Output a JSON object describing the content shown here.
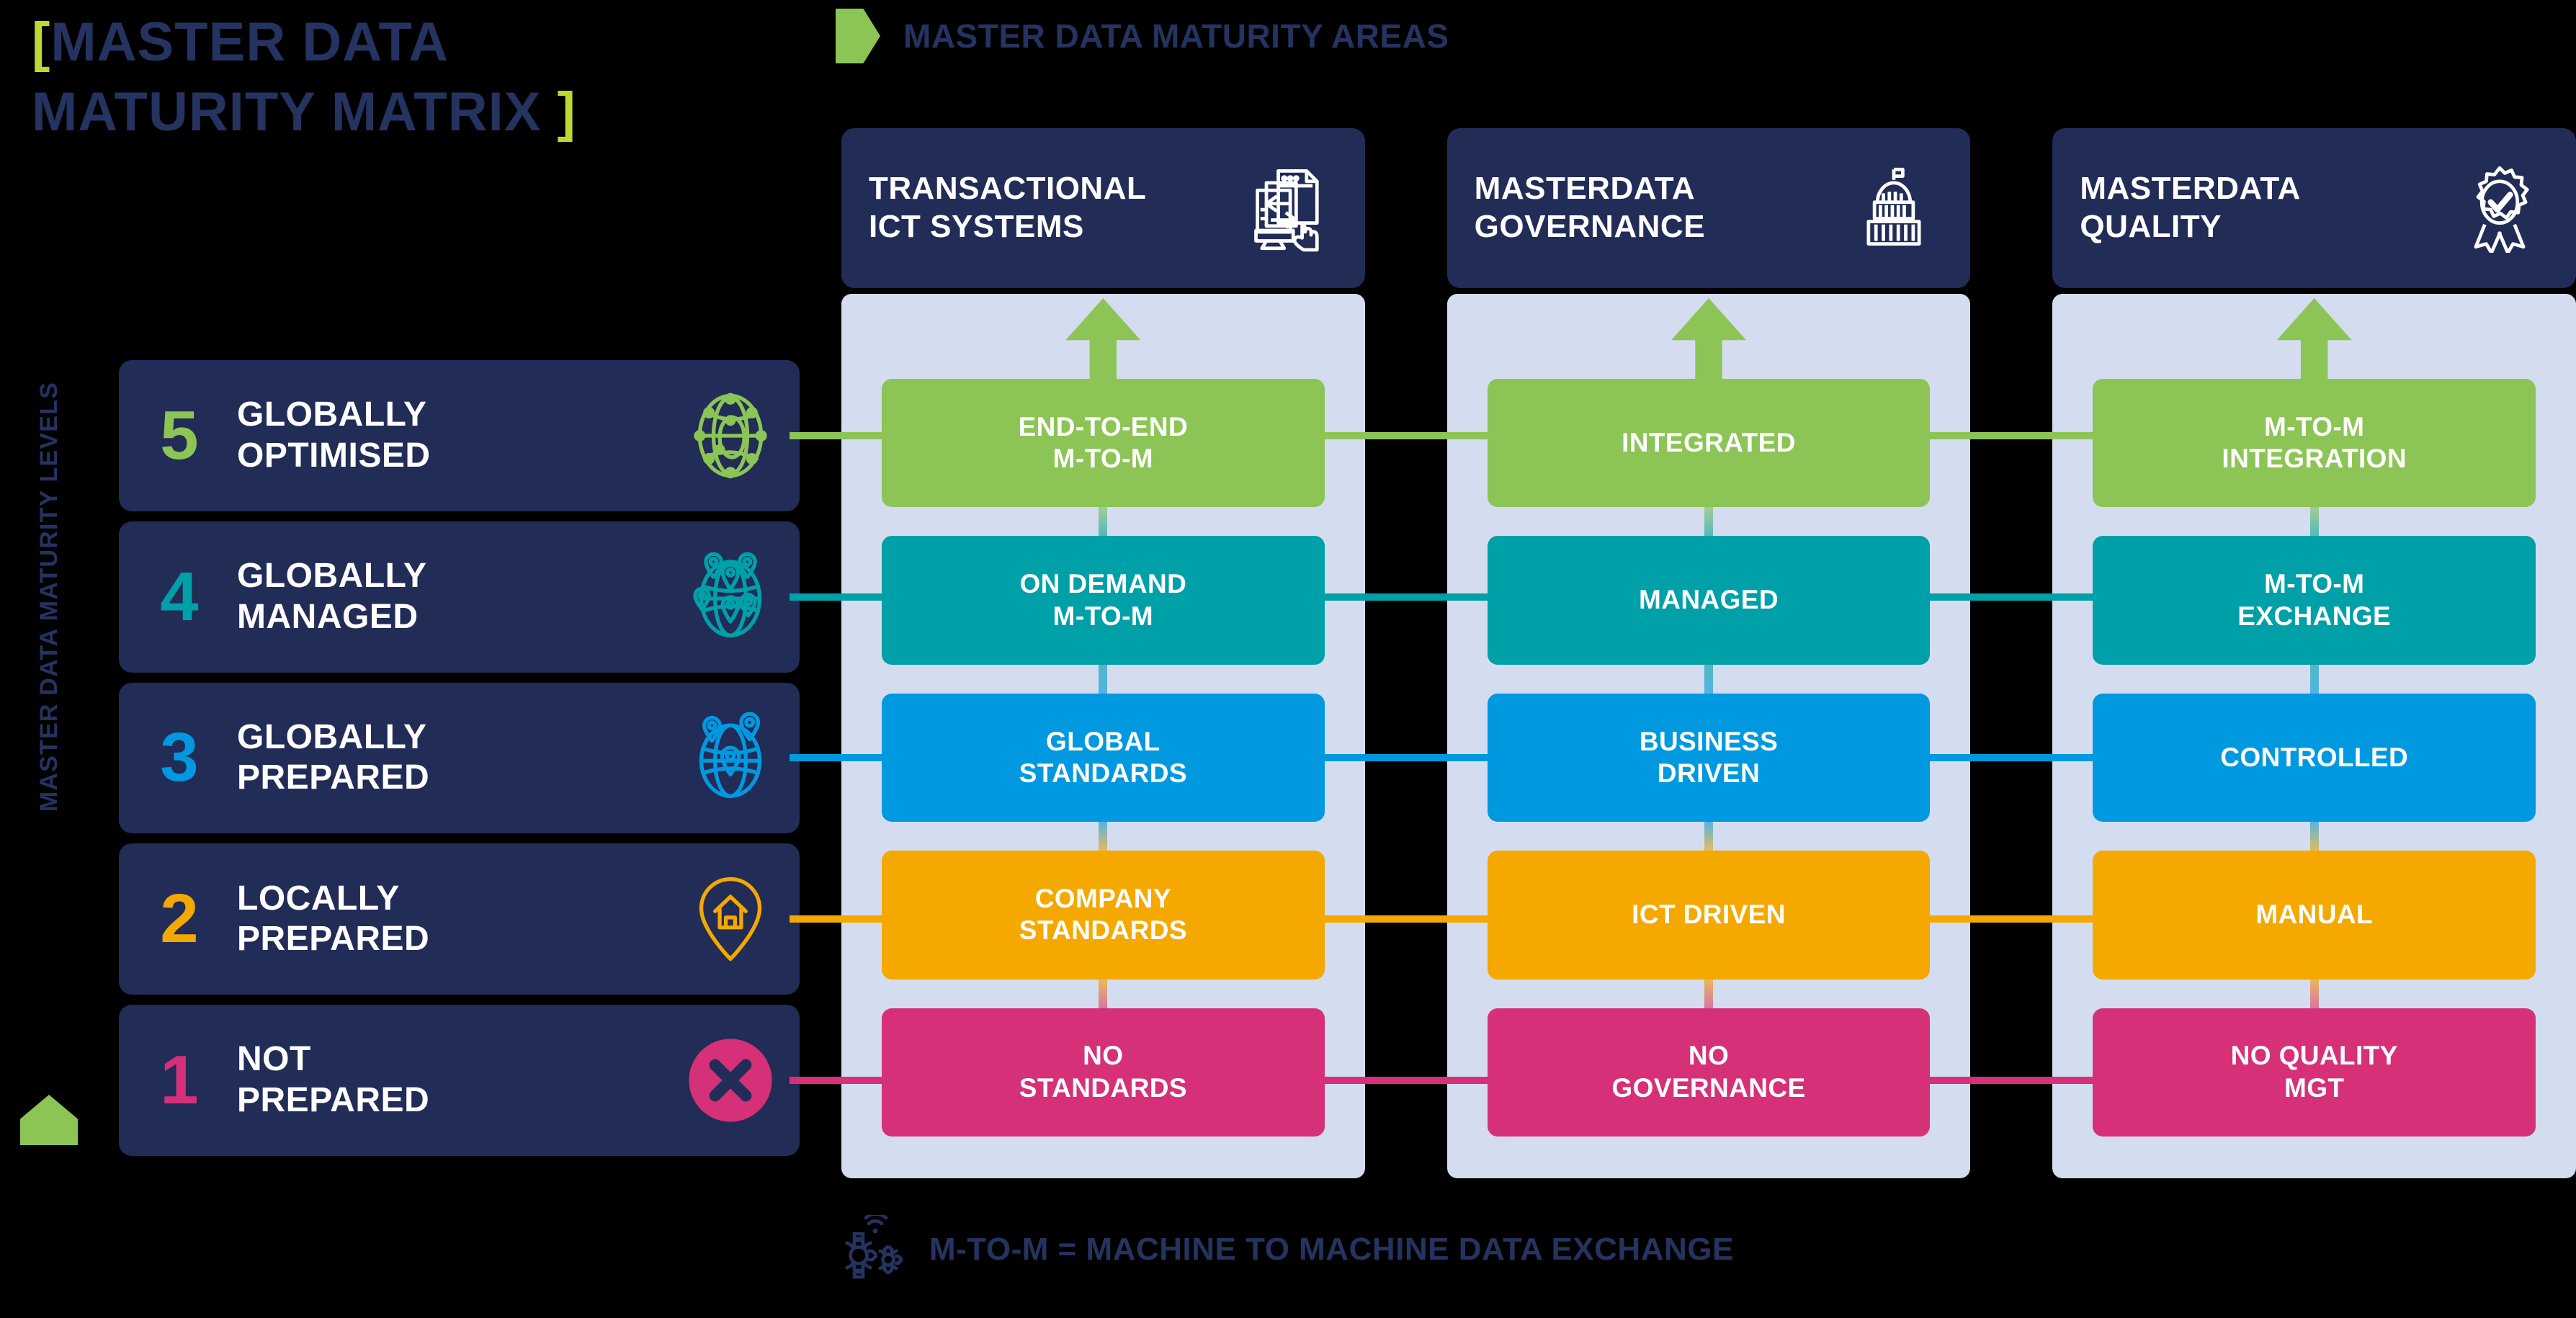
{
  "title": {
    "bracket_open": "[",
    "line1": "MASTER  DATA",
    "line2": "MATURITY MATRIX",
    "bracket_close": "]",
    "bracket_color": "#BFD730",
    "text_color": "#253360"
  },
  "areas_heading": {
    "label": "MASTER DATA MATURITY AREAS",
    "chevron_color": "#8CC456"
  },
  "levels_axis": {
    "label": "MASTER DATA MATURITY LEVELS",
    "arrow_color": "#8CC456"
  },
  "levels": [
    {
      "number": "5",
      "title_line1": "GLOBALLY",
      "title_line2": "OPTIMISED",
      "color": "#8CC456",
      "icon": "globe-network-icon"
    },
    {
      "number": "4",
      "title_line1": "GLOBALLY",
      "title_line2": "MANAGED",
      "color": "#00A0A8",
      "icon": "globe-multi-pin-icon"
    },
    {
      "number": "3",
      "title_line1": "GLOBALLY",
      "title_line2": "PREPARED",
      "color": "#0099E0",
      "icon": "globe-pin-icon"
    },
    {
      "number": "2",
      "title_line1": "LOCALLY",
      "title_line2": "PREPARED",
      "color": "#F5A800",
      "icon": "home-pin-icon"
    },
    {
      "number": "1",
      "title_line1": "NOT",
      "title_line2": "PREPARED",
      "color": "#D63078",
      "icon": "cross-circle-icon"
    }
  ],
  "areas": [
    {
      "title_line1": "TRANSACTIONAL",
      "title_line2": "ICT SYSTEMS",
      "icon": "document-exchange-icon",
      "cells": [
        {
          "line1": "END-TO-END",
          "line2": "M-TO-M"
        },
        {
          "line1": "ON DEMAND",
          "line2": "M-TO-M"
        },
        {
          "line1": "GLOBAL",
          "line2": "STANDARDS"
        },
        {
          "line1": "COMPANY",
          "line2": "STANDARDS"
        },
        {
          "line1": "NO",
          "line2": "STANDARDS"
        }
      ]
    },
    {
      "title_line1": "MASTERDATA",
      "title_line2": "GOVERNANCE",
      "icon": "government-building-icon",
      "cells": [
        {
          "line1": "INTEGRATED",
          "line2": ""
        },
        {
          "line1": "MANAGED",
          "line2": ""
        },
        {
          "line1": "BUSINESS",
          "line2": "DRIVEN"
        },
        {
          "line1": "ICT DRIVEN",
          "line2": ""
        },
        {
          "line1": "NO",
          "line2": "GOVERNANCE"
        }
      ]
    },
    {
      "title_line1": "MASTERDATA",
      "title_line2": "QUALITY",
      "icon": "award-check-badge-icon",
      "cells": [
        {
          "line1": "M-TO-M",
          "line2": "INTEGRATION"
        },
        {
          "line1": "M-TO-M",
          "line2": "EXCHANGE"
        },
        {
          "line1": "CONTROLLED",
          "line2": ""
        },
        {
          "line1": "MANUAL",
          "line2": ""
        },
        {
          "line1": "NO QUALITY",
          "line2": "MGT"
        }
      ]
    }
  ],
  "row_colors": [
    "#8CC456",
    "#00A0A8",
    "#0099E0",
    "#F5A800",
    "#D63078"
  ],
  "footer": {
    "label": "M-TO-M = MACHINE TO MACHINE DATA EXCHANGE",
    "icon": "gears-wifi-icon",
    "color": "#253360"
  },
  "palette": {
    "background": "#000000",
    "navy": "#212C57",
    "panel_fill": "#D4DDEF",
    "heading_text": "#253360"
  }
}
